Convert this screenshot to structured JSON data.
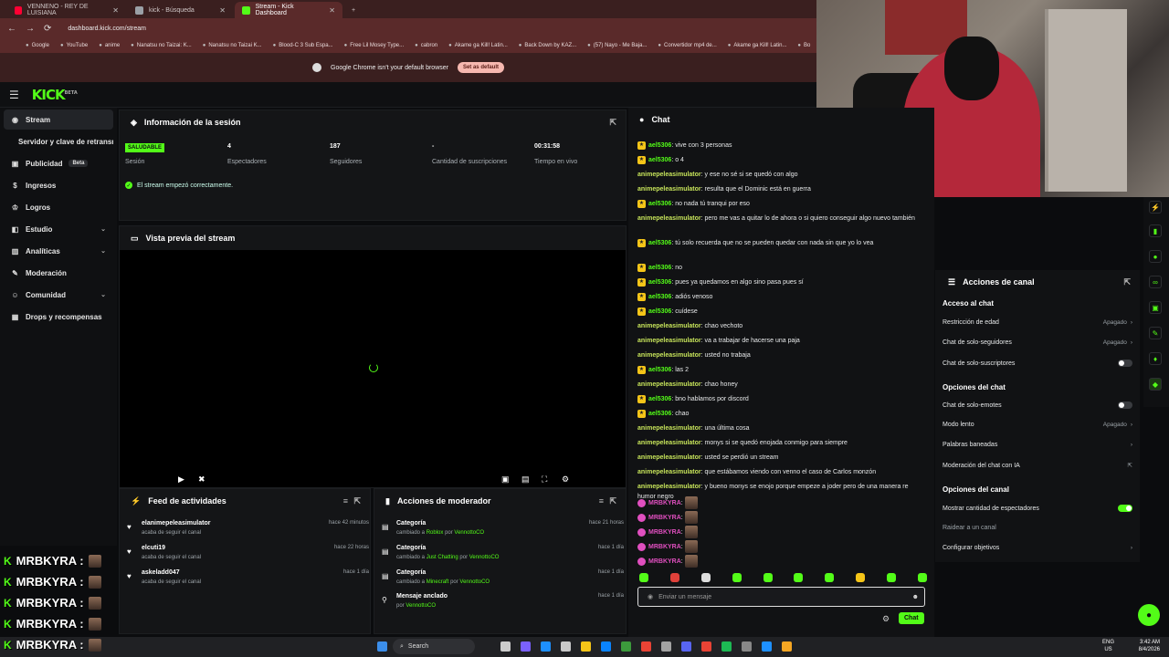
{
  "browser": {
    "tabs": [
      {
        "label": "VENNENO - REY DE LUISIANA",
        "color": "#ff0033"
      },
      {
        "label": "kick - Búsqueda",
        "color": "#9aa0a6"
      },
      {
        "label": "Stream - Kick Dashboard",
        "color": "#53fc18"
      }
    ],
    "url": "dashboard.kick.com/stream",
    "bookmarks": [
      "Google",
      "YouTube",
      "anime",
      "Nanatsu no Taizai: K...",
      "Nanatsu no Taizai K...",
      "Blood-C 3 Sub Espa...",
      "Free Lil Mosey Type...",
      "cabron",
      "Akame ga Kill! Latin...",
      "Back Down by KAZ...",
      "(57) Nayo - Me Baja...",
      "Convertidor mp4 de...",
      "Akame ga Kill! Latin...",
      "Bo"
    ],
    "default_msg": "Google Chrome isn't your default browser",
    "default_btn": "Set as default"
  },
  "kick": {
    "logo": "KICK",
    "beta": "BETA"
  },
  "sidebar": {
    "items": [
      {
        "label": "Stream",
        "icon": "radio-icon"
      },
      {
        "label": "Servidor y clave de retransmisión"
      },
      {
        "label": "Publicidad",
        "badge": "Beta"
      },
      {
        "label": "Ingresos"
      },
      {
        "label": "Logros"
      },
      {
        "label": "Estudio"
      },
      {
        "label": "Analíticas"
      },
      {
        "label": "Moderación"
      },
      {
        "label": "Comunidad"
      },
      {
        "label": "Drops y recompensas"
      }
    ]
  },
  "session": {
    "title": "Información de la sesión",
    "status": "SALUDABLE",
    "status_label": "Sesión",
    "viewers": "4",
    "viewers_label": "Espectadores",
    "followers": "187",
    "followers_label": "Seguidores",
    "subs": "-",
    "subs_label": "Cantidad de suscripciones",
    "live_time": "00:31:58",
    "live_label": "Tiempo en vivo",
    "ok_msg": "El stream empezó correctamente."
  },
  "preview": {
    "title": "Vista previa del stream"
  },
  "feed": {
    "title": "Feed de actividades",
    "rows": [
      {
        "name": "elanimepeleasimulator",
        "sub": "acaba de seguir el canal",
        "time": "hace 42 minutos"
      },
      {
        "name": "elcuti19",
        "sub": "acaba de seguir el canal",
        "time": "hace 22 horas"
      },
      {
        "name": "askeladd047",
        "sub": "acaba de seguir el canal",
        "time": "hace 1 día"
      }
    ]
  },
  "mod": {
    "title": "Acciones de moderador",
    "rows": [
      {
        "name": "Categoría",
        "pre": "cambiado a",
        "target": "Roblox",
        "by": "por",
        "user": "VennottoCO",
        "time": "hace 21 horas"
      },
      {
        "name": "Categoría",
        "pre": "cambiado a",
        "target": "Just Chatting",
        "by": "por",
        "user": "VennottoCO",
        "time": "hace 1 día"
      },
      {
        "name": "Categoría",
        "pre": "cambiado a",
        "target": "Minecraft",
        "by": "por",
        "user": "VennottoCO",
        "time": "hace 1 día"
      },
      {
        "name": "Mensaje anclado",
        "pre": "por",
        "target": "VennottoCO",
        "by": "",
        "user": "",
        "time": "hace 1 día"
      }
    ]
  },
  "chat": {
    "title": "Chat",
    "messages": [
      {
        "user": "ael5306",
        "badge": true,
        "color": "#53fc18",
        "text": "vive con 3 personas"
      },
      {
        "user": "ael5306",
        "badge": true,
        "color": "#53fc18",
        "text": "o 4"
      },
      {
        "user": "animepeleasimulator",
        "badge": false,
        "color": "#c6e35a",
        "text": "y ese no sé si se quedó con algo"
      },
      {
        "user": "animepeleasimulator",
        "badge": false,
        "color": "#c6e35a",
        "text": "resulta que el Dominic está en guerra"
      },
      {
        "user": "ael5306",
        "badge": true,
        "color": "#53fc18",
        "text": "no nada tú tranqui por eso"
      },
      {
        "user": "animepeleasimulator",
        "badge": false,
        "color": "#c6e35a",
        "text": "pero me vas a quitar lo de ahora o si quiero conseguir algo nuevo también"
      },
      {
        "user": "ael5306",
        "badge": true,
        "color": "#53fc18",
        "text": "tú solo recuerda que no se pueden quedar con nada sin que yo lo vea"
      },
      {
        "user": "ael5306",
        "badge": true,
        "color": "#53fc18",
        "text": "no"
      },
      {
        "user": "ael5306",
        "badge": true,
        "color": "#53fc18",
        "text": "pues ya quedamos en algo sino pasa pues sí"
      },
      {
        "user": "ael5306",
        "badge": true,
        "color": "#53fc18",
        "text": "adiós venoso"
      },
      {
        "user": "ael5306",
        "badge": true,
        "color": "#53fc18",
        "text": "cuídese"
      },
      {
        "user": "animepeleasimulator",
        "badge": false,
        "color": "#c6e35a",
        "text": "chao vechoto"
      },
      {
        "user": "animepeleasimulator",
        "badge": false,
        "color": "#c6e35a",
        "text": "va a trabajar de hacerse una paja"
      },
      {
        "user": "animepeleasimulator",
        "badge": false,
        "color": "#c6e35a",
        "text": "usted no trabaja"
      },
      {
        "user": "ael5306",
        "badge": true,
        "color": "#53fc18",
        "text": "las 2"
      },
      {
        "user": "animepeleasimulator",
        "badge": false,
        "color": "#c6e35a",
        "text": "chao honey"
      },
      {
        "user": "ael5306",
        "badge": true,
        "color": "#53fc18",
        "text": "bno hablamos por discord"
      },
      {
        "user": "ael5306",
        "badge": true,
        "color": "#53fc18",
        "text": "chao"
      },
      {
        "user": "animepeleasimulator",
        "badge": false,
        "color": "#c6e35a",
        "text": "una última cosa"
      },
      {
        "user": "animepeleasimulator",
        "badge": false,
        "color": "#c6e35a",
        "text": "monys si se quedó enojada conmigo para siempre"
      },
      {
        "user": "animepeleasimulator",
        "badge": false,
        "color": "#c6e35a",
        "text": "usted se perdió un stream"
      },
      {
        "user": "animepeleasimulator",
        "badge": false,
        "color": "#c6e35a",
        "text": "que estábamos viendo con venno el caso de Carlos monzón"
      },
      {
        "user": "animepeleasimulator",
        "badge": false,
        "color": "#c6e35a",
        "text": "y bueno monys se enojo porque empeze a joder pero de una manera re humor negro"
      }
    ],
    "emote_users": [
      "MRBKYRA",
      "MRBKYRA",
      "MRBKYRA",
      "MRBKYRA",
      "MRBKYRA"
    ],
    "placeholder": "Enviar un mensaje",
    "send": "Chat"
  },
  "channel": {
    "title": "Acciones de canal",
    "sec_access": "Acceso al chat",
    "age": "Restricción de edad",
    "age_val": "Apagado",
    "followers": "Chat de solo-seguidores",
    "followers_val": "Apagado",
    "subs": "Chat de solo-suscriptores",
    "sec_options": "Opciones del chat",
    "emotes": "Chat de solo-emotes",
    "slow": "Modo lento",
    "slow_val": "Apagado",
    "banned": "Palabras baneadas",
    "ai": "Moderación del chat con IA",
    "sec_channel": "Opciones del canal",
    "show_viewers": "Mostrar cantidad de espectadores",
    "raid": "Raidear a un canal",
    "goals": "Configurar objetivos"
  },
  "overlay": {
    "users": [
      "MRBKYRA :",
      "MRBKYRA :",
      "MRBKYRA :",
      "MRBKYRA :",
      "MRBKYRA :"
    ]
  },
  "taskbar": {
    "search": "Search",
    "lang": "ENG",
    "region": "US",
    "time": "3:42 AM",
    "date": "8/4/2026"
  }
}
